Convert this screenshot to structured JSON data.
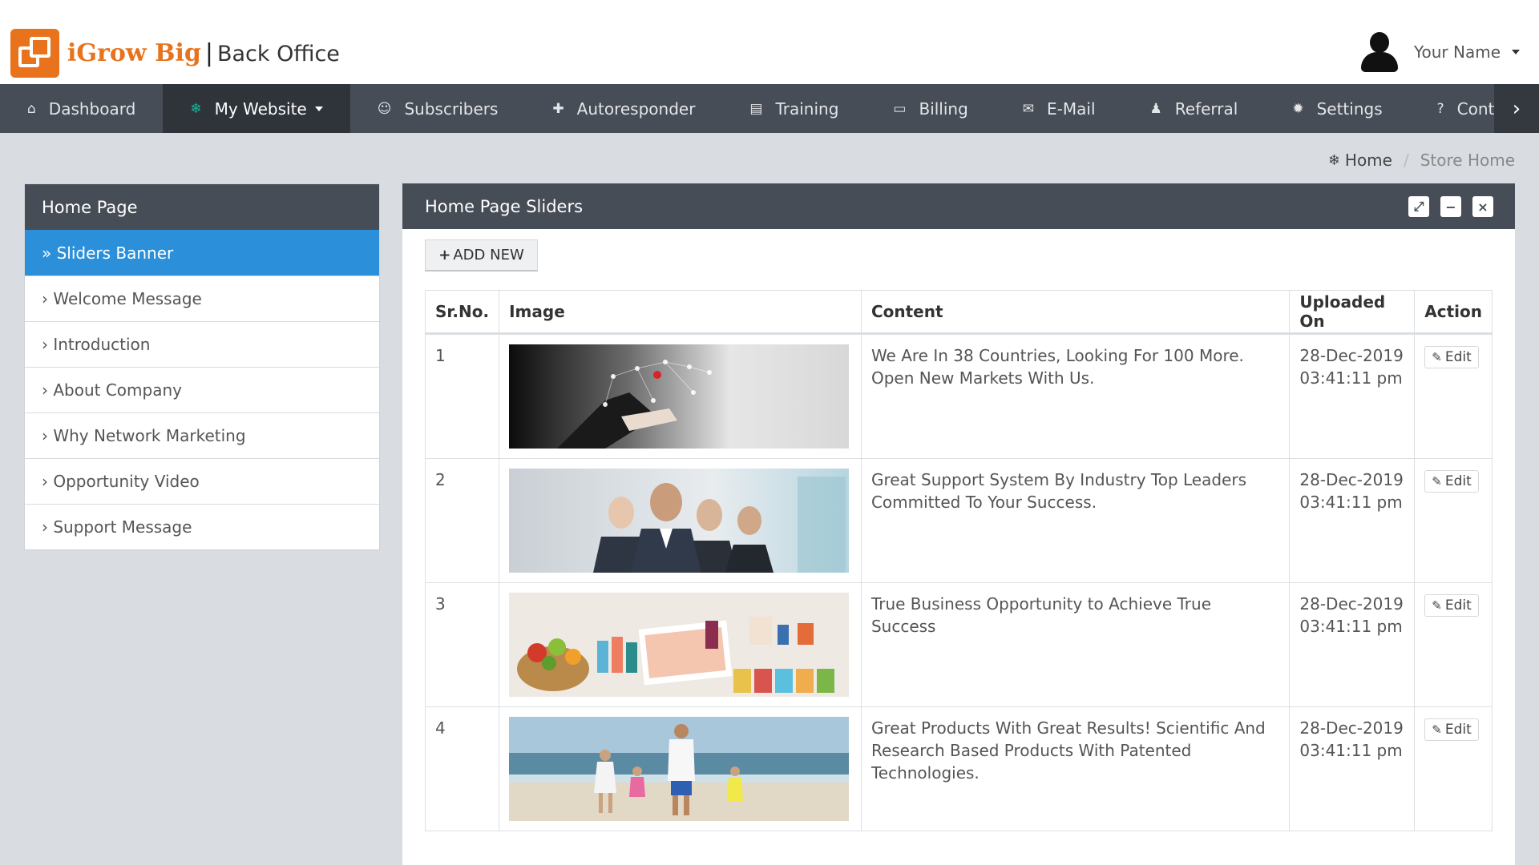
{
  "header": {
    "brand": "iGrow Big",
    "separator": "|",
    "subtitle": "Back Office",
    "user_name": "Your Name"
  },
  "nav": {
    "items": [
      {
        "label": "Dashboard",
        "icon": "home-icon",
        "glyph": "⌂"
      },
      {
        "label": "My Website",
        "icon": "snowflake-icon",
        "glyph": "❄"
      },
      {
        "label": "Subscribers",
        "icon": "smiley-icon",
        "glyph": "☺"
      },
      {
        "label": "Autoresponder",
        "icon": "puzzle-icon",
        "glyph": "✚"
      },
      {
        "label": "Training",
        "icon": "book-icon",
        "glyph": "▤"
      },
      {
        "label": "Billing",
        "icon": "credit-card-icon",
        "glyph": "▭"
      },
      {
        "label": "E-Mail",
        "icon": "inbox-icon",
        "glyph": "✉"
      },
      {
        "label": "Referral",
        "icon": "user-icon",
        "glyph": "♟"
      },
      {
        "label": "Settings",
        "icon": "gear-icon",
        "glyph": "✹"
      },
      {
        "label": "Contact Us",
        "icon": "question-icon",
        "glyph": "?"
      }
    ],
    "active_index": 1,
    "scroll_glyph": "›"
  },
  "breadcrumb": {
    "home_icon": "❄",
    "home": "Home",
    "separator": "/",
    "current": "Store Home"
  },
  "sidebar": {
    "title": "Home Page",
    "items": [
      "» Sliders Banner",
      "› Welcome Message",
      "› Introduction",
      "› About Company",
      "› Why Network Marketing",
      "› Opportunity Video",
      "› Support Message"
    ]
  },
  "panel": {
    "title": "Home Page Sliders",
    "tools": {
      "expand": "⤢",
      "minimize": "−",
      "close": "×"
    },
    "add_plus": "+",
    "add_label": "ADD NEW"
  },
  "table": {
    "headers": {
      "sr": "Sr.No.",
      "image": "Image",
      "content": "Content",
      "uploaded": "Uploaded On",
      "action": "Action"
    },
    "edit_label": "Edit",
    "edit_icon": "✎",
    "rows": [
      {
        "sr": "1",
        "image": "business-network-image",
        "content": "We Are In 38 Countries, Looking For 100 More. Open New Markets With Us.",
        "date": "28-Dec-2019",
        "time": "03:41:11 pm"
      },
      {
        "sr": "2",
        "image": "business-team-image",
        "content": "Great Support System By Industry Top Leaders Committed To Your Success.",
        "date": "28-Dec-2019",
        "time": "03:41:11 pm"
      },
      {
        "sr": "3",
        "image": "health-products-image",
        "content": "True Business Opportunity to Achieve True Success",
        "date": "28-Dec-2019",
        "time": "03:41:11 pm"
      },
      {
        "sr": "4",
        "image": "family-beach-image",
        "content": "Great Products With Great Results! Scientific And Research Based Products With Patented Technologies.",
        "date": "28-Dec-2019",
        "time": "03:41:11 pm"
      }
    ]
  }
}
